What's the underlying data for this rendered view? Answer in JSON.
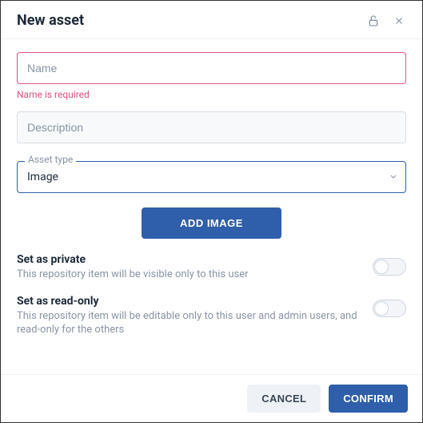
{
  "header": {
    "title": "New asset"
  },
  "fields": {
    "name": {
      "placeholder": "Name",
      "value": "",
      "error": "Name is required"
    },
    "description": {
      "placeholder": "Description",
      "value": ""
    },
    "assetType": {
      "label": "Asset type",
      "selected": "Image"
    }
  },
  "buttons": {
    "addImage": "ADD IMAGE",
    "cancel": "CANCEL",
    "confirm": "CONFIRM"
  },
  "toggles": {
    "private": {
      "title": "Set as private",
      "desc": "This repository item will be visible only to this user"
    },
    "readonly": {
      "title": "Set as read-only",
      "desc": "This repository item will be editable only to this user and admin users, and read-only for the others"
    }
  }
}
